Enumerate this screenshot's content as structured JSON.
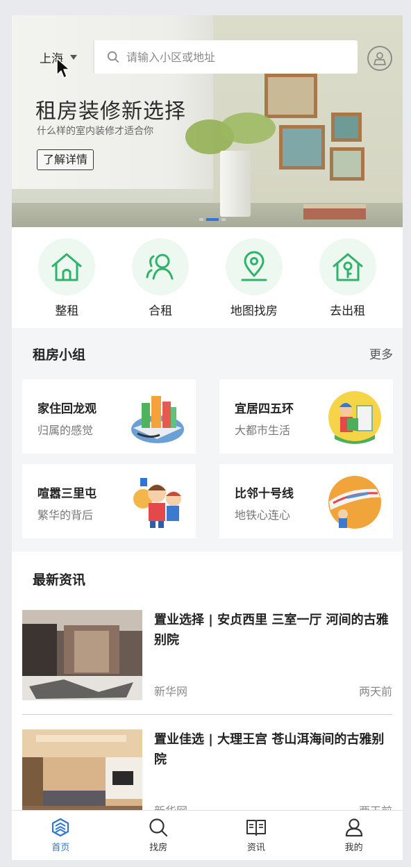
{
  "header": {
    "city": "上海",
    "search_placeholder": "请输入小区或地址"
  },
  "banner": {
    "title": "租房装修新选择",
    "subtitle": "什么样的室内装修才适合你",
    "button": "了解详情",
    "slide_count": 3,
    "active_slide": 1
  },
  "categories": [
    {
      "label": "整租",
      "icon": "house-icon"
    },
    {
      "label": "合租",
      "icon": "people-icon"
    },
    {
      "label": "地图找房",
      "icon": "map-pin-icon"
    },
    {
      "label": "去出租",
      "icon": "house-key-icon"
    }
  ],
  "groups": {
    "title": "租房小组",
    "more": "更多",
    "items": [
      {
        "title": "家住回龙观",
        "subtitle": "归属的感觉",
        "icon": "city-buildings-illustration"
      },
      {
        "title": "宜居四五环",
        "subtitle": "大都市生活",
        "icon": "delivery-man-illustration"
      },
      {
        "title": "喧嚣三里屯",
        "subtitle": "繁华的背后",
        "icon": "crowd-illustration"
      },
      {
        "title": "比邻十号线",
        "subtitle": "地铁心连心",
        "icon": "subway-train-illustration"
      }
    ]
  },
  "news": {
    "title": "最新资讯",
    "items": [
      {
        "title": "置业选择 | 安贞西里 三室一厅 河间的古雅别院",
        "source": "新华网",
        "time": "两天前"
      },
      {
        "title": "置业佳选 | 大理王宫 苍山洱海间的古雅别院",
        "source": "新华网",
        "time": "两天前"
      }
    ]
  },
  "tabbar": [
    {
      "label": "首页",
      "icon": "home-cube-icon",
      "active": true
    },
    {
      "label": "找房",
      "icon": "search-icon",
      "active": false
    },
    {
      "label": "资讯",
      "icon": "book-icon",
      "active": false
    },
    {
      "label": "我的",
      "icon": "person-icon",
      "active": false
    }
  ],
  "colors": {
    "accent": "#2d75d6",
    "green": "#2fb36a",
    "green_bg": "#edf8f0"
  }
}
